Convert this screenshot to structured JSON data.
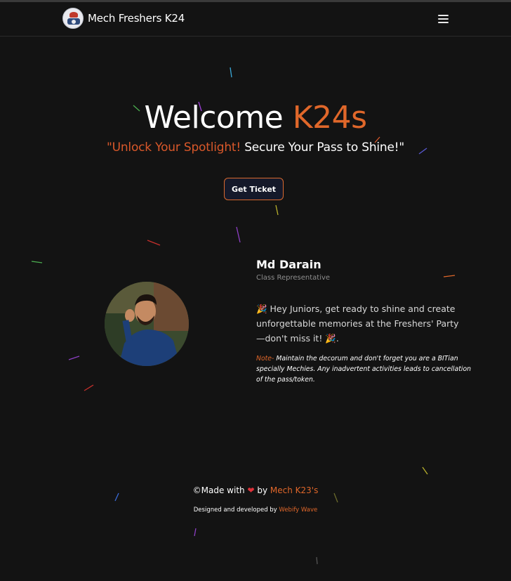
{
  "nav": {
    "brand_name": "Mech Freshers K24"
  },
  "hero": {
    "title_main": "Welcome ",
    "title_accent": "K24s",
    "tagline_accent": "\"Unlock Your Spotlight!",
    "tagline_rest": " Secure Your Pass to Shine!\"",
    "cta_label": "Get Ticket"
  },
  "profile": {
    "name": "Md Darain",
    "role": "Class Representative",
    "message": "🎉 Hey Juniors, get ready to shine and create unforgettable memories at the Freshers' Party—don't miss it! 🎉.",
    "note_label": "Note-",
    "note_text": " Maintain the decorum and don't forget you are a BITian specially Mechies. Any inadvertent activities leads to cancellation of the pass/token."
  },
  "footer": {
    "made_with": "©Made with ",
    "heart": "❤",
    "by": " by ",
    "credit": "Mech K23's",
    "designed_by": "Designed and developed by ",
    "developer": "Webify Wave"
  },
  "colors": {
    "accent": "#e0672a",
    "background": "#131313",
    "button_bg": "#15192a"
  },
  "icons": {
    "menu": "hamburger-menu-icon",
    "logo": "college-logo-icon"
  }
}
